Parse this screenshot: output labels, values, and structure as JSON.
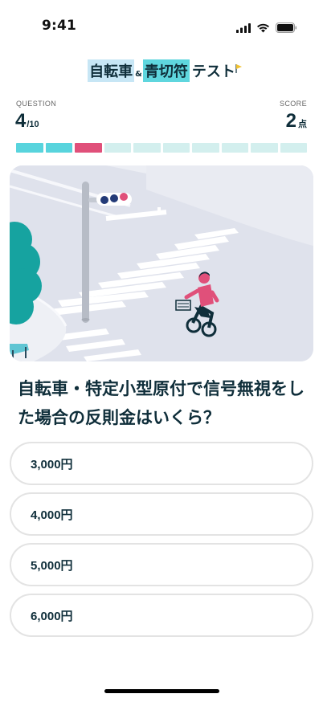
{
  "status_bar": {
    "time": "9:41"
  },
  "title": {
    "part1": "自転車",
    "amp": "&",
    "part2": "青切符",
    "part3": "テスト"
  },
  "header": {
    "question_label": "QUESTION",
    "question_current": "4",
    "question_total": "/10",
    "score_label": "SCORE",
    "score_value": "2",
    "score_unit": "点"
  },
  "progress": {
    "segments": [
      "correct",
      "correct",
      "wrong",
      "pending",
      "pending",
      "pending",
      "pending",
      "pending",
      "pending",
      "pending"
    ],
    "colors": {
      "correct": "#58d4dd",
      "wrong": "#e0507a",
      "pending": "#d3efee"
    }
  },
  "question": {
    "text": "自転車・特定小型原付で信号無視をした場合の反則金はいくら？"
  },
  "options": [
    {
      "label": "3,000円"
    },
    {
      "label": "4,000円"
    },
    {
      "label": "5,000円"
    },
    {
      "label": "6,000円"
    }
  ],
  "colors": {
    "text": "#0f2e3a",
    "accent_teal": "#58d4dd",
    "accent_pink": "#e0507a"
  }
}
